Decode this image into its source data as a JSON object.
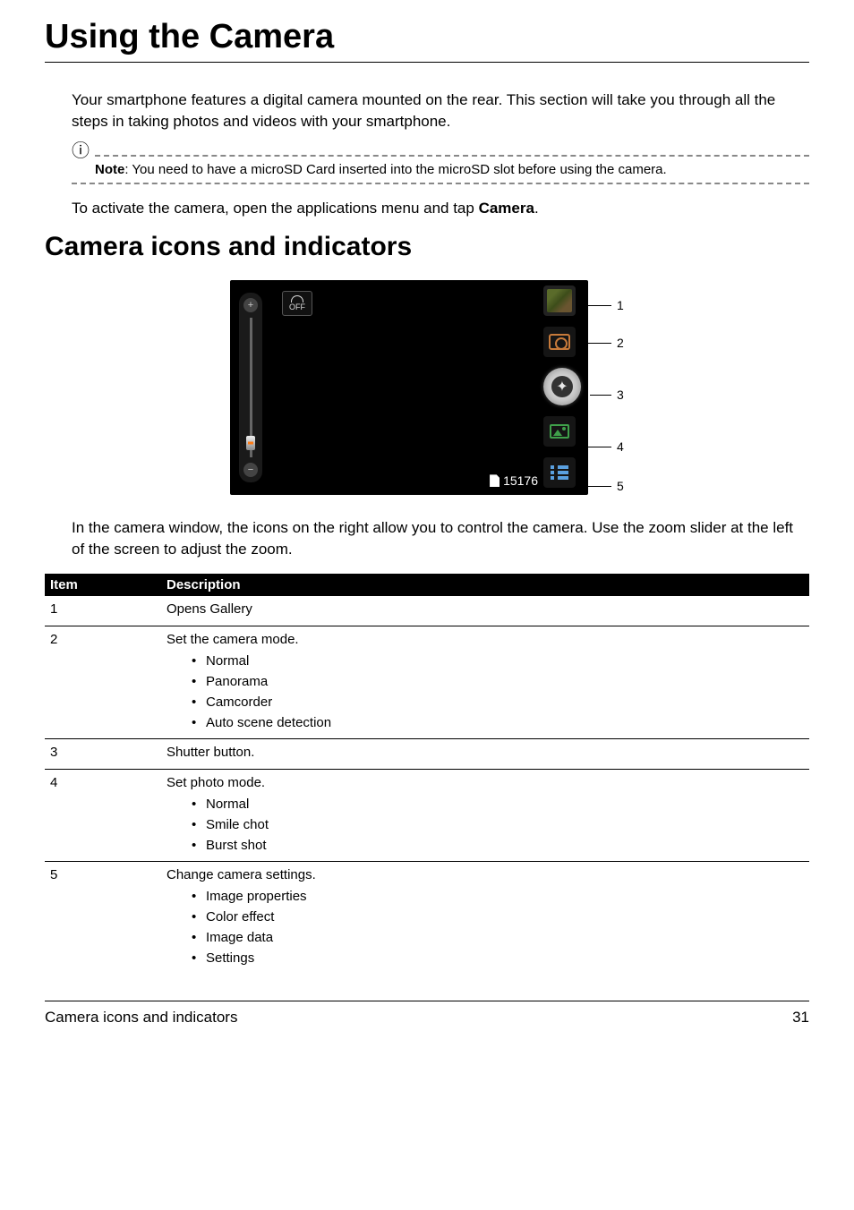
{
  "page_title": "Using the Camera",
  "intro": "Your smartphone features a digital camera mounted on the rear. This section will take you through all the steps in taking photos and videos with your smartphone.",
  "note": {
    "label": "Note",
    "text": ": You need to have a microSD Card inserted into the microSD slot before using the camera."
  },
  "activate": {
    "prefix": "To activate the camera, open the applications menu and tap ",
    "target": "Camera",
    "suffix": "."
  },
  "section_heading": "Camera icons and indicators",
  "diagram": {
    "off_label": "OFF",
    "remaining": "15176",
    "callouts": [
      "1",
      "2",
      "3",
      "4",
      "5"
    ]
  },
  "post_diagram": "In the camera window, the icons on the right allow you to control the camera. Use the zoom slider at the left of the screen to adjust the zoom.",
  "table": {
    "headers": {
      "item": "Item",
      "desc": "Description"
    },
    "rows": [
      {
        "item": "1",
        "desc": "Opens Gallery",
        "bullets": []
      },
      {
        "item": "2",
        "desc": "Set the camera mode.",
        "bullets": [
          "Normal",
          "Panorama",
          "Camcorder",
          "Auto scene detection"
        ]
      },
      {
        "item": "3",
        "desc": "Shutter button.",
        "bullets": []
      },
      {
        "item": "4",
        "desc": "Set photo mode.",
        "bullets": [
          "Normal",
          "Smile chot",
          "Burst shot"
        ]
      },
      {
        "item": "5",
        "desc": "Change camera settings.",
        "bullets": [
          "Image properties",
          "Color effect",
          "Image data",
          "Settings"
        ]
      }
    ]
  },
  "footer": {
    "left": "Camera icons and indicators",
    "right": "31"
  }
}
